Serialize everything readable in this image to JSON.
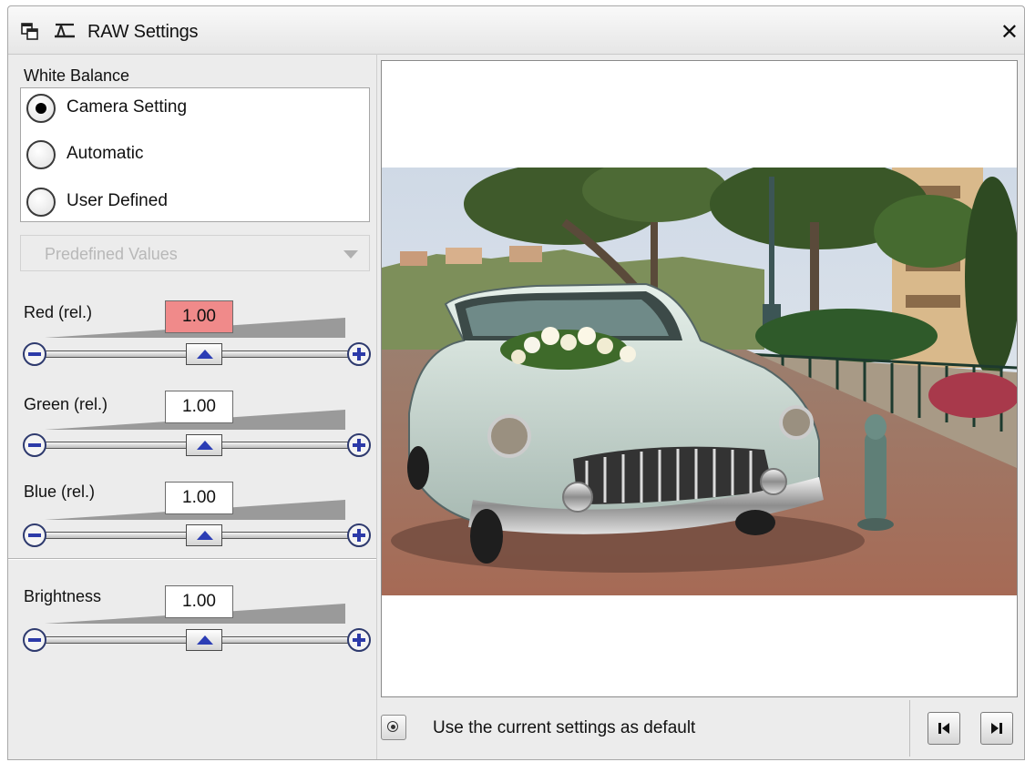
{
  "window": {
    "title": "RAW Settings",
    "icons": [
      "restore-window-icon",
      "pin-icon",
      "close-icon"
    ],
    "close_glyph": "✕"
  },
  "white_balance": {
    "label": "White Balance",
    "options": [
      {
        "label": "Camera Setting",
        "selected": true
      },
      {
        "label": "Automatic",
        "selected": false
      },
      {
        "label": "User Defined",
        "selected": false
      }
    ],
    "predefined": {
      "label": "Predefined Values",
      "enabled": false
    }
  },
  "adjustments": {
    "red": {
      "label": "Red (rel.)",
      "value": "1.00",
      "active": true,
      "level": 0.5
    },
    "green": {
      "label": "Green (rel.)",
      "value": "1.00",
      "active": false,
      "level": 0.5
    },
    "blue": {
      "label": "Blue (rel.)",
      "value": "1.00",
      "active": false,
      "level": 0.5
    },
    "brightness": {
      "label": "Brightness",
      "value": "1.00",
      "active": false,
      "level": 0.5
    }
  },
  "footer": {
    "default_label": "Use the current settings as default",
    "nav_icons": [
      "first-frame-icon",
      "last-frame-icon"
    ]
  },
  "colors": {
    "active_field": "#f08a8a",
    "slider_accent": "#2b3db5",
    "window_bg": "#ececec"
  }
}
